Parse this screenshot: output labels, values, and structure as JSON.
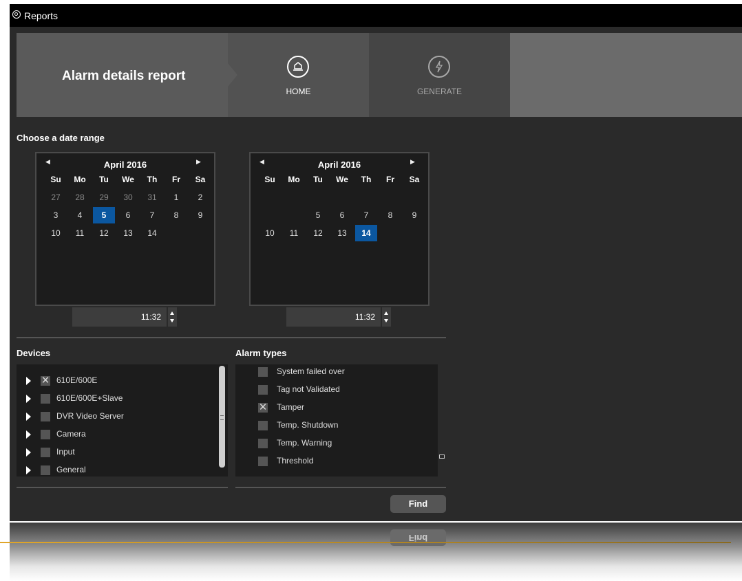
{
  "window": {
    "title": "Reports"
  },
  "header": {
    "report_title": "Alarm details report",
    "steps": [
      {
        "label": "HOME",
        "icon": "home-icon",
        "active": true
      },
      {
        "label": "GENERATE",
        "icon": "lightning-icon",
        "active": false
      }
    ]
  },
  "date_range": {
    "title": "Choose a date range",
    "weekdays": [
      "Su",
      "Mo",
      "Tu",
      "We",
      "Th",
      "Fr",
      "Sa"
    ],
    "start": {
      "month": "April 2016",
      "rows": [
        [
          "27",
          "28",
          "29",
          "30",
          "31",
          "1",
          "2"
        ],
        [
          "3",
          "4",
          "5",
          "6",
          "7",
          "8",
          "9"
        ],
        [
          "10",
          "11",
          "12",
          "13",
          "14",
          "",
          ""
        ]
      ],
      "muted": [
        [
          0,
          0
        ],
        [
          0,
          1
        ],
        [
          0,
          2
        ],
        [
          0,
          3
        ],
        [
          0,
          4
        ]
      ],
      "selected": [
        1,
        2
      ],
      "time": "11:32"
    },
    "end": {
      "month": "April 2016",
      "rows": [
        [
          "",
          "",
          "",
          "",
          "",
          "",
          ""
        ],
        [
          "",
          "",
          "5",
          "6",
          "7",
          "8",
          "9"
        ],
        [
          "10",
          "11",
          "12",
          "13",
          "14",
          "",
          ""
        ]
      ],
      "muted": [],
      "selected": [
        2,
        4
      ],
      "time": "11:32"
    }
  },
  "devices": {
    "title": "Devices",
    "items": [
      {
        "label": "610E/600E",
        "checked": true
      },
      {
        "label": "610E/600E+Slave",
        "checked": false
      },
      {
        "label": "DVR Video Server",
        "checked": false
      },
      {
        "label": "Camera",
        "checked": false
      },
      {
        "label": "Input",
        "checked": false
      },
      {
        "label": "General",
        "checked": false
      }
    ]
  },
  "alarm_types": {
    "title": "Alarm types",
    "items": [
      {
        "label": "System failed over",
        "checked": false
      },
      {
        "label": "Tag not Validated",
        "checked": false
      },
      {
        "label": "Tamper",
        "checked": true
      },
      {
        "label": "Temp. Shutdown",
        "checked": false
      },
      {
        "label": "Temp. Warning",
        "checked": false
      },
      {
        "label": "Threshold",
        "checked": false
      }
    ]
  },
  "actions": {
    "find_label": "Find"
  },
  "colors": {
    "selected_day": "#0b57a0",
    "accent_line": "#e0a62a",
    "background": "#2a2a2a"
  }
}
